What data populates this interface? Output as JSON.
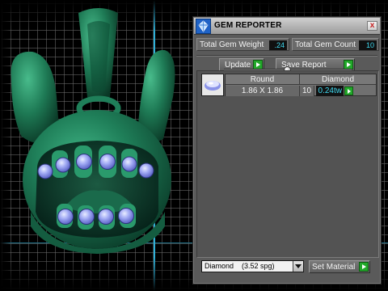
{
  "panel": {
    "title": "GEM REPORTER",
    "close_glyph": "x",
    "icon": "gem-reporter-app-icon",
    "total_weight_label": "Total Gem Weight",
    "total_weight_value": ".24",
    "total_count_label": "Total Gem Count",
    "total_count_value": "10",
    "update_label": "Update",
    "save_report_label": "Save Report",
    "table": {
      "headers": [
        "Round",
        "Diamond"
      ],
      "rows": [
        {
          "shape": "Round",
          "size": "1.86 X 1.86",
          "count": "10",
          "weight": "0.24tw",
          "material": "Diamond"
        }
      ]
    },
    "material_select": {
      "name": "Diamond",
      "spg": "(3.52 spg)"
    },
    "set_material_label": "Set Material"
  },
  "viewport": {
    "model": "bunny-skull-pendant",
    "metal_color": "#1f7f59",
    "gem_color": "#8d97ee",
    "gem_count": 10
  },
  "colors": {
    "accent_green": "#22a82a",
    "value_cyan": "#3fd9f0",
    "axis_blue": "#2fb0d8"
  }
}
